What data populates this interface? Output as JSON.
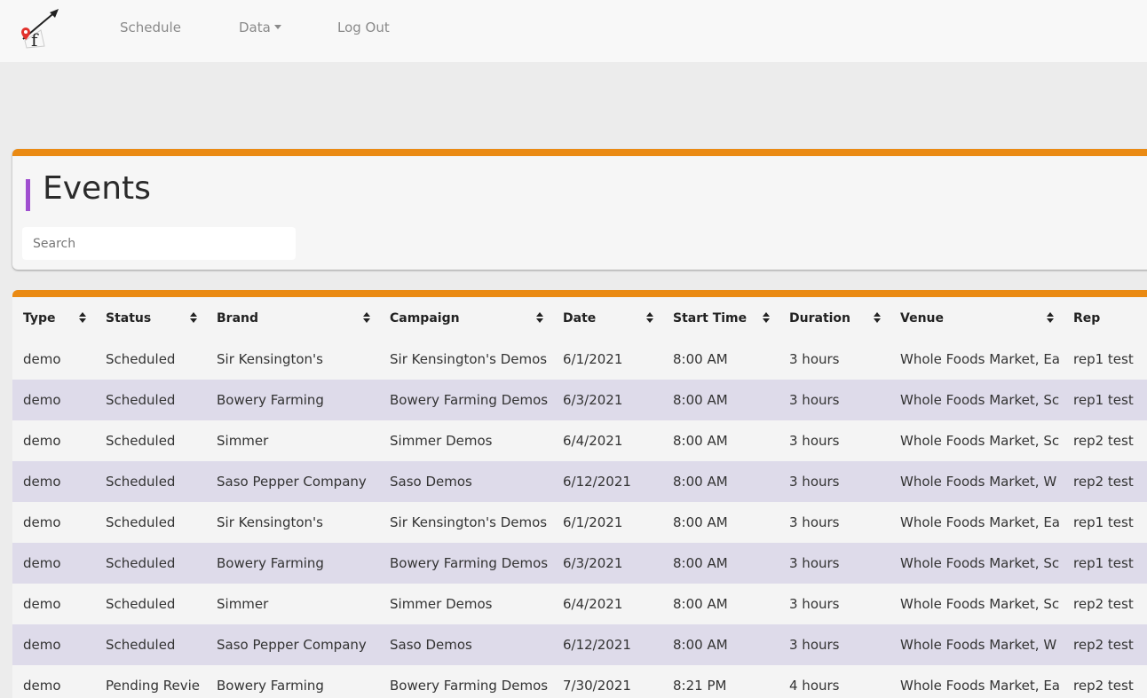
{
  "nav": {
    "links": [
      "Schedule",
      "Data",
      "Log Out"
    ],
    "logo_icon": "route-arrow-logo",
    "accent": "#ea8a13"
  },
  "page": {
    "title": "Events",
    "title_accent": "#a04fd0",
    "search_placeholder": "Search"
  },
  "table": {
    "columns": [
      "Type",
      "Status",
      "Brand",
      "Campaign",
      "Date",
      "Start Time",
      "Duration",
      "Venue",
      "Rep"
    ],
    "sortable": [
      true,
      true,
      true,
      true,
      true,
      true,
      true,
      true,
      false
    ],
    "row_stripe": "#dedbea",
    "rows": [
      [
        "demo",
        "Scheduled",
        "Sir Kensington's",
        "Sir Kensington's Demos",
        "6/1/2021",
        "8:00 AM",
        "3 hours",
        "Whole Foods Market, Ea",
        "rep1 test"
      ],
      [
        "demo",
        "Scheduled",
        "Bowery Farming",
        "Bowery Farming Demos",
        "6/3/2021",
        "8:00 AM",
        "3 hours",
        "Whole Foods Market, Sc",
        "rep1 test"
      ],
      [
        "demo",
        "Scheduled",
        "Simmer",
        "Simmer Demos",
        "6/4/2021",
        "8:00 AM",
        "3 hours",
        "Whole Foods Market, Sc",
        "rep2 test"
      ],
      [
        "demo",
        "Scheduled",
        "Saso Pepper Company",
        "Saso Demos",
        "6/12/2021",
        "8:00 AM",
        "3 hours",
        "Whole Foods Market, W",
        "rep2 test"
      ],
      [
        "demo",
        "Scheduled",
        "Sir Kensington's",
        "Sir Kensington's Demos",
        "6/1/2021",
        "8:00 AM",
        "3 hours",
        "Whole Foods Market, Ea",
        "rep1 test"
      ],
      [
        "demo",
        "Scheduled",
        "Bowery Farming",
        "Bowery Farming Demos",
        "6/3/2021",
        "8:00 AM",
        "3 hours",
        "Whole Foods Market, Sc",
        "rep1 test"
      ],
      [
        "demo",
        "Scheduled",
        "Simmer",
        "Simmer Demos",
        "6/4/2021",
        "8:00 AM",
        "3 hours",
        "Whole Foods Market, Sc",
        "rep2 test"
      ],
      [
        "demo",
        "Scheduled",
        "Saso Pepper Company",
        "Saso Demos",
        "6/12/2021",
        "8:00 AM",
        "3 hours",
        "Whole Foods Market, W",
        "rep2 test"
      ],
      [
        "demo",
        "Pending Revie",
        "Bowery Farming",
        "Bowery Farming Demos",
        "7/30/2021",
        "8:21 PM",
        "4 hours",
        "Whole Foods Market, Ea",
        "rep2 test"
      ]
    ]
  }
}
